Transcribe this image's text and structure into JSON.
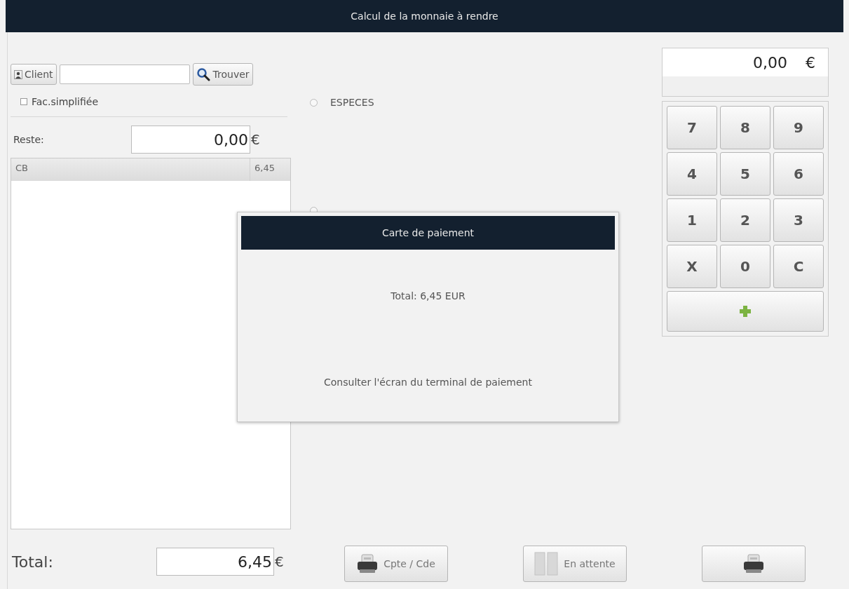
{
  "window": {
    "title": "Calcul de la monnaie à rendre"
  },
  "client": {
    "button": "Client",
    "search_button": "Trouver"
  },
  "simplified_invoice": {
    "label": "Fac.simplifiée",
    "checked": false
  },
  "remaining": {
    "label": "Reste:",
    "value": "0,00",
    "currency": "€"
  },
  "payments": [
    {
      "method": "CB",
      "amount": "6,45"
    }
  ],
  "total": {
    "label": "Total:",
    "value": "6,45",
    "currency": "€"
  },
  "payment_methods": [
    {
      "label": "ESPECES",
      "selected": false
    },
    {
      "selected": false
    }
  ],
  "display": {
    "value": "0,00",
    "currency": "€"
  },
  "keypad": [
    "7",
    "8",
    "9",
    "4",
    "5",
    "6",
    "1",
    "2",
    "3",
    "X",
    "0",
    "C"
  ],
  "actions": [
    {
      "kind": "printer",
      "label": "Cpte / Cde"
    },
    {
      "kind": "hold",
      "label": "En attente"
    },
    {
      "kind": "printer"
    }
  ],
  "dialog": {
    "title": "Carte de paiement",
    "total": "Total: 6,45 EUR",
    "message": "Consulter l'écran du terminal de paiement"
  }
}
